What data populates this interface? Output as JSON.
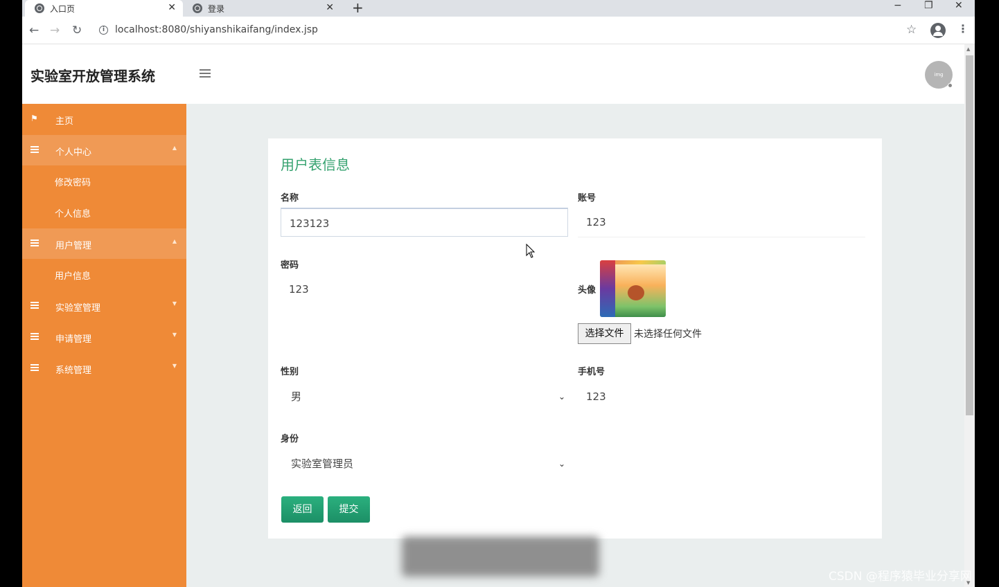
{
  "browser": {
    "tabs": [
      {
        "label": "入口页",
        "active": true
      },
      {
        "label": "登录",
        "active": false
      }
    ],
    "url": "localhost:8080/shiyanshikaifang/index.jsp"
  },
  "header": {
    "title": "实验室开放管理系统",
    "avatar_text": "img"
  },
  "sidebar": {
    "items": [
      {
        "label": "主页",
        "icon": "flag-icon"
      },
      {
        "label": "个人中心",
        "icon": "grid-icon",
        "expanded": true
      },
      {
        "label": "修改密码",
        "sub": true
      },
      {
        "label": "个人信息",
        "sub": true
      },
      {
        "label": "用户管理",
        "icon": "grid-icon",
        "expanded": true
      },
      {
        "label": "用户信息",
        "sub": true
      },
      {
        "label": "实验室管理",
        "icon": "grid-icon"
      },
      {
        "label": "申请管理",
        "icon": "grid-icon"
      },
      {
        "label": "系统管理",
        "icon": "grid-icon"
      }
    ]
  },
  "form": {
    "title": "用户表信息",
    "name_label": "名称",
    "name_value": "123123",
    "account_label": "账号",
    "account_value": "123",
    "password_label": "密码",
    "password_value": "123",
    "avatar_label": "头像",
    "file_button": "选择文件",
    "file_status": "未选择任何文件",
    "gender_label": "性别",
    "gender_value": "男",
    "phone_label": "手机号",
    "phone_value": "123",
    "role_label": "身份",
    "role_value": "实验室管理员",
    "back_button": "返回",
    "submit_button": "提交"
  },
  "watermark": "CSDN @程序猿毕业分享网",
  "colors": {
    "sidebar": "#ef8a37",
    "accent": "#35a26f",
    "button": "#1c8f66"
  }
}
